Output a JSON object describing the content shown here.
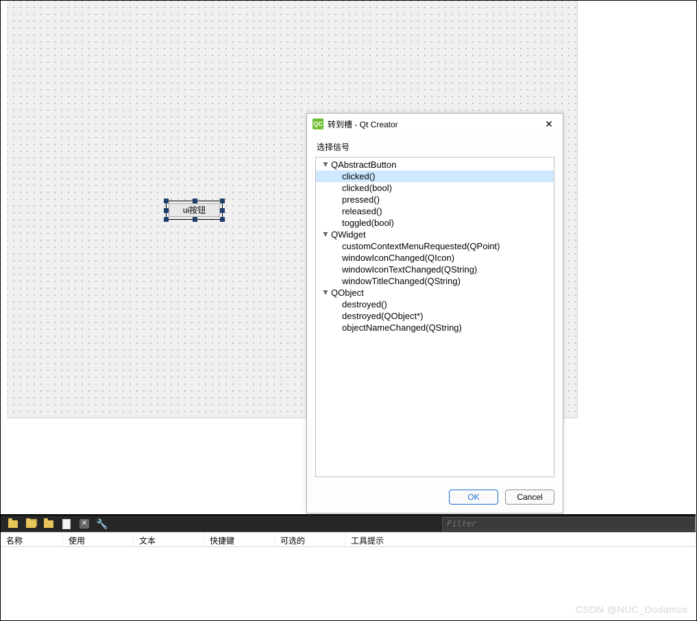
{
  "canvas": {
    "button_label": "ui按钮"
  },
  "dialog": {
    "icon_text": "QC",
    "title": "转到槽 - Qt Creator",
    "select_label": "选择信号",
    "ok_label": "OK",
    "cancel_label": "Cancel",
    "tree": [
      {
        "name": "QAbstractButton",
        "signals": [
          {
            "sig": "clicked()",
            "selected": true
          },
          {
            "sig": "clicked(bool)"
          },
          {
            "sig": "pressed()"
          },
          {
            "sig": "released()"
          },
          {
            "sig": "toggled(bool)"
          }
        ]
      },
      {
        "name": "QWidget",
        "signals": [
          {
            "sig": "customContextMenuRequested(QPoint)"
          },
          {
            "sig": "windowIconChanged(QIcon)"
          },
          {
            "sig": "windowIconTextChanged(QString)"
          },
          {
            "sig": "windowTitleChanged(QString)"
          }
        ]
      },
      {
        "name": "QObject",
        "signals": [
          {
            "sig": "destroyed()"
          },
          {
            "sig": "destroyed(QObject*)"
          },
          {
            "sig": "objectNameChanged(QString)"
          }
        ]
      }
    ]
  },
  "bottom": {
    "filter_placeholder": "Filter",
    "columns": [
      "名称",
      "使用",
      "文本",
      "快捷键",
      "可选的",
      "工具提示"
    ]
  },
  "watermark": "CSDN @NUC_Dodamce"
}
